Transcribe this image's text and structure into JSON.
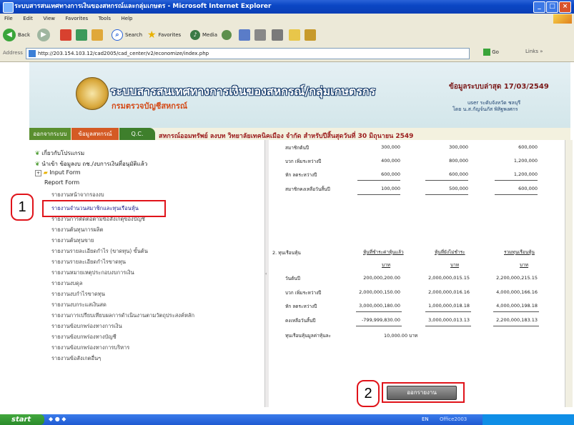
{
  "window": {
    "title": "ระบบสารสนเทศทางการเงินของสหกรณ์และกลุ่มเกษตร - Microsoft Internet Explorer",
    "min_label": "_",
    "max_label": "□",
    "close_label": "×"
  },
  "menubar": {
    "items": [
      "File",
      "Edit",
      "View",
      "Favorites",
      "Tools",
      "Help"
    ]
  },
  "toolbar": {
    "back_label": "Back",
    "search_label": "Search",
    "favorites_label": "Favorites",
    "media_label": "Media"
  },
  "addressbar": {
    "label": "Address",
    "url": "http://203.154.103.12/cad2005/cad_center/v2/economize/index.php",
    "go_label": "Go",
    "links_label": "Links"
  },
  "header": {
    "title": "ระบบสารสนเทศทางการเงินของสหกรณ์/กลุ่มเกษตรกร",
    "subtitle": "กรมตรวจบัญชีสหกรณ์",
    "date": "ข้อมูลระบบล่าสุด 17/03/2549",
    "user_line1": "user ระดับจังหวัด ชลบุรี",
    "user_line2": "โดย น.ส.กัญจ์นภัส พิสิฐพงศกร"
  },
  "nav": {
    "tabs": [
      "ออกจากระบบ",
      "ข้อมูลสหกรณ์",
      "Q.C."
    ],
    "report_title": "สหกรณ์ออมทรัพย์ ลงบท วิทยาลัยเทคนิคเมือง จำกัด สำหรับปีสิ้นสุดวันที่ 30 มิถุนายน 2549"
  },
  "left": {
    "items": [
      {
        "label": "เกี่ยวกับโปรแกรม"
      },
      {
        "label": "นำเข้า ข้อมูลงบ ถช./งบการเงินที่อนุมัติแล้ว"
      },
      {
        "label": "Input Form"
      },
      {
        "label": "Report Form"
      }
    ],
    "subitems": [
      "รายงานหน้าจากรองงบ",
      "รายงานจำนวนสมาชิกและทุนเรือนหุ้น",
      "รายงานการติดต่อตามข้อสังเกตุของบัญชี",
      "รายงานต้นทุนการผลิต",
      "รายงานต้นทุนขาย",
      "รายงานรายละเอียดกำไร (ขาดทุน) ขั้นต้น",
      "รายงานรายละเอียดกำไรขาดทุน",
      "รายงานหมายเหตุประกอบงบการเงิน",
      "รายงานงบดุล",
      "รายงานงบกำไรขาดทุน",
      "รายงานงบกระแสเงินสด",
      "รายงานการเปรียบเทียบผลการดำเนินงานตามวัตถุประสงค์หลัก",
      "รายงานข้อบกพร่องทางการเงิน",
      "รายงานข้อบกพร่องทางบัญชี",
      "รายงานข้อบกพร่องทางการบริหาร",
      "รายงานข้อสังเกตอื่นๆ"
    ]
  },
  "callouts": {
    "one": "1",
    "two": "2"
  },
  "right": {
    "top_rows": [
      {
        "label": "สมาชิกต้นปี",
        "c1": "300,000",
        "c2": "300,000",
        "c3": "600,000"
      },
      {
        "label": "บวก เพิ่มระหว่างปี",
        "c1": "400,000",
        "c2": "800,000",
        "c3": "1,200,000"
      },
      {
        "label": "หัก ลดระหว่างปี",
        "c1": "600,000",
        "c2": "600,000",
        "c3": "1,200,000"
      },
      {
        "label": "สมาชิกคงเหลือวันสิ้นปี",
        "c1": "100,000",
        "c2": "500,000",
        "c3": "600,000"
      }
    ],
    "section_title": "2. ทุนเรือนหุ้น",
    "col_headers": [
      "หุ้นที่ชำระค่าหุ้นแล้ว",
      "หุ้นที่ยังไม่ชำระ",
      "รวมทุนเรือนหุ้น"
    ],
    "col_units": [
      "บาท",
      "บาท",
      "บาท"
    ],
    "rows": [
      {
        "label": "วันต้นปี",
        "c1": "200,000,200.00",
        "c2": "2,000,000,015.15",
        "c3": "2,200,000,215.15"
      },
      {
        "label": "บวก เพิ่มระหว่างปี",
        "c1": "2,000,000,150.00",
        "c2": "2,000,000,016.16",
        "c3": "4,000,000,166.16"
      },
      {
        "label": "หัก ลดระหว่างปี",
        "c1": "3,000,000,180.00",
        "c2": "1,000,000,018.18",
        "c3": "4,000,000,198.18"
      },
      {
        "label": "คงเหลือวันสิ้นปี",
        "c1": "-799,999,830.00",
        "c2": "3,000,000,013.13",
        "c3": "2,200,000,183.13"
      }
    ],
    "share_value": "ทุนเรือนหุ้นมูลค่าหุ้นละ",
    "share_value_amount": "10,000.00 บาท",
    "exit_button": "ออกรายงาน"
  },
  "taskbar": {
    "start_label": "start",
    "lang": "EN",
    "app_label": "Office2003"
  }
}
